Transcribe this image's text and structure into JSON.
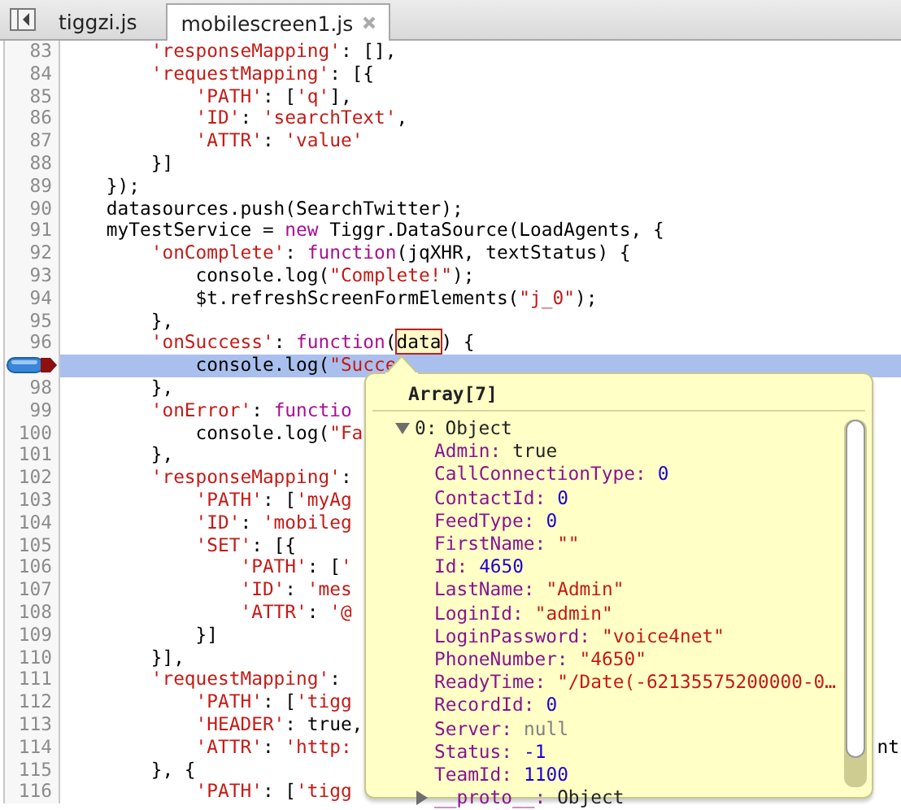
{
  "tabs": [
    {
      "label": "tiggzi.js",
      "selected": false,
      "closable": false
    },
    {
      "label": "mobilescreen1.js",
      "selected": true,
      "closable": true
    }
  ],
  "editor": {
    "lines": [
      {
        "number": "83",
        "tokens": [
          {
            "kind": "string",
            "text": "        'responseMapping'"
          },
          {
            "kind": "plain",
            "text": ": [],"
          }
        ]
      },
      {
        "number": "84",
        "tokens": [
          {
            "kind": "string",
            "text": "        'requestMapping'"
          },
          {
            "kind": "plain",
            "text": ": [{"
          }
        ]
      },
      {
        "number": "85",
        "tokens": [
          {
            "kind": "string",
            "text": "            'PATH'"
          },
          {
            "kind": "plain",
            "text": ": ["
          },
          {
            "kind": "string",
            "text": "'q'"
          },
          {
            "kind": "plain",
            "text": "],"
          }
        ]
      },
      {
        "number": "86",
        "tokens": [
          {
            "kind": "string",
            "text": "            'ID'"
          },
          {
            "kind": "plain",
            "text": ": "
          },
          {
            "kind": "string",
            "text": "'searchText'"
          },
          {
            "kind": "plain",
            "text": ","
          }
        ]
      },
      {
        "number": "87",
        "tokens": [
          {
            "kind": "string",
            "text": "            'ATTR'"
          },
          {
            "kind": "plain",
            "text": ": "
          },
          {
            "kind": "string",
            "text": "'value'"
          }
        ]
      },
      {
        "number": "88",
        "tokens": [
          {
            "kind": "plain",
            "text": "        }]"
          }
        ]
      },
      {
        "number": "89",
        "tokens": [
          {
            "kind": "plain",
            "text": "    });"
          }
        ]
      },
      {
        "number": "90",
        "tokens": [
          {
            "kind": "plain",
            "text": "    datasources.push(SearchTwitter);"
          }
        ]
      },
      {
        "number": "91",
        "tokens": [
          {
            "kind": "plain",
            "text": "    myTestService = "
          },
          {
            "kind": "keyword",
            "text": "new"
          },
          {
            "kind": "plain",
            "text": " Tiggr.DataSource(LoadAgents, {"
          }
        ]
      },
      {
        "number": "92",
        "tokens": [
          {
            "kind": "string",
            "text": "        'onComplete'"
          },
          {
            "kind": "plain",
            "text": ": "
          },
          {
            "kind": "keyword",
            "text": "function"
          },
          {
            "kind": "plain",
            "text": "(jqXHR, textStatus) {"
          }
        ]
      },
      {
        "number": "93",
        "tokens": [
          {
            "kind": "plain",
            "text": "            console.log("
          },
          {
            "kind": "string",
            "text": "\"Complete!\""
          },
          {
            "kind": "plain",
            "text": ");"
          }
        ]
      },
      {
        "number": "94",
        "tokens": [
          {
            "kind": "plain",
            "text": "            $t.refreshScreenFormElements("
          },
          {
            "kind": "string",
            "text": "\"j_0\""
          },
          {
            "kind": "plain",
            "text": ");"
          }
        ]
      },
      {
        "number": "95",
        "tokens": [
          {
            "kind": "plain",
            "text": "        },"
          }
        ]
      },
      {
        "number": "96",
        "tokens": [
          {
            "kind": "string",
            "text": "        'onSuccess'"
          },
          {
            "kind": "plain",
            "text": ": "
          },
          {
            "kind": "keyword",
            "text": "function"
          },
          {
            "kind": "plain",
            "text": "("
          },
          {
            "kind": "hover",
            "text": "data"
          },
          {
            "kind": "plain",
            "text": ") {"
          }
        ]
      },
      {
        "current": true,
        "breakpoint": true,
        "tokens": [
          {
            "kind": "plain",
            "text": "            console.log("
          },
          {
            "kind": "string",
            "text": "\"Succe"
          }
        ]
      },
      {
        "number": "98",
        "tokens": [
          {
            "kind": "plain",
            "text": "        },"
          }
        ]
      },
      {
        "number": "99",
        "tokens": [
          {
            "kind": "string",
            "text": "        'onError'"
          },
          {
            "kind": "plain",
            "text": ": "
          },
          {
            "kind": "keyword",
            "text": "functio"
          }
        ]
      },
      {
        "number": "100",
        "tokens": [
          {
            "kind": "plain",
            "text": "            console.log("
          },
          {
            "kind": "string",
            "text": "\"Fa"
          }
        ]
      },
      {
        "number": "101",
        "tokens": [
          {
            "kind": "plain",
            "text": "        },"
          }
        ]
      },
      {
        "number": "102",
        "tokens": [
          {
            "kind": "string",
            "text": "        'responseMapping'"
          },
          {
            "kind": "plain",
            "text": ":"
          }
        ]
      },
      {
        "number": "103",
        "tokens": [
          {
            "kind": "string",
            "text": "            'PATH'"
          },
          {
            "kind": "plain",
            "text": ": ["
          },
          {
            "kind": "string",
            "text": "'myAg"
          }
        ]
      },
      {
        "number": "104",
        "tokens": [
          {
            "kind": "string",
            "text": "            'ID'"
          },
          {
            "kind": "plain",
            "text": ": "
          },
          {
            "kind": "string",
            "text": "'mobileg"
          }
        ]
      },
      {
        "number": "105",
        "tokens": [
          {
            "kind": "string",
            "text": "            'SET'"
          },
          {
            "kind": "plain",
            "text": ": [{"
          }
        ]
      },
      {
        "number": "106",
        "tokens": [
          {
            "kind": "string",
            "text": "                'PATH'"
          },
          {
            "kind": "plain",
            "text": ": ["
          },
          {
            "kind": "string",
            "text": "'"
          }
        ]
      },
      {
        "number": "107",
        "tokens": [
          {
            "kind": "string",
            "text": "                'ID'"
          },
          {
            "kind": "plain",
            "text": ": "
          },
          {
            "kind": "string",
            "text": "'mes"
          }
        ]
      },
      {
        "number": "108",
        "tokens": [
          {
            "kind": "string",
            "text": "                'ATTR'"
          },
          {
            "kind": "plain",
            "text": ": "
          },
          {
            "kind": "string",
            "text": "'@"
          }
        ]
      },
      {
        "number": "109",
        "tokens": [
          {
            "kind": "plain",
            "text": "            }]"
          }
        ]
      },
      {
        "number": "110",
        "tokens": [
          {
            "kind": "plain",
            "text": "        }],"
          }
        ]
      },
      {
        "number": "111",
        "tokens": [
          {
            "kind": "string",
            "text": "        'requestMapping'"
          },
          {
            "kind": "plain",
            "text": ":"
          }
        ]
      },
      {
        "number": "112",
        "tokens": [
          {
            "kind": "string",
            "text": "            'PATH'"
          },
          {
            "kind": "plain",
            "text": ": ["
          },
          {
            "kind": "string",
            "text": "'tigg"
          }
        ]
      },
      {
        "number": "113",
        "tokens": [
          {
            "kind": "string",
            "text": "            'HEADER'"
          },
          {
            "kind": "plain",
            "text": ": true,"
          }
        ]
      },
      {
        "number": "114",
        "tokens": [
          {
            "kind": "string",
            "text": "            'ATTR'"
          },
          {
            "kind": "plain",
            "text": ": "
          },
          {
            "kind": "string",
            "text": "'http:"
          }
        ],
        "tail": "nt"
      },
      {
        "number": "115",
        "tokens": [
          {
            "kind": "plain",
            "text": "        }, {"
          }
        ]
      },
      {
        "number": "116",
        "tokens": [
          {
            "kind": "string",
            "text": "            'PATH'"
          },
          {
            "kind": "plain",
            "text": ": ["
          },
          {
            "kind": "string",
            "text": "'tigg"
          }
        ]
      }
    ]
  },
  "popover": {
    "title": "Array[7]",
    "items": [
      {
        "key": "0:",
        "value": "Object",
        "kind": "object",
        "expanded": true,
        "children": [
          {
            "key": "Admin:",
            "value": "true",
            "kind": "boolean"
          },
          {
            "key": "CallConnectionType:",
            "value": "0",
            "kind": "number"
          },
          {
            "key": "ContactId:",
            "value": "0",
            "kind": "number"
          },
          {
            "key": "FeedType:",
            "value": "0",
            "kind": "number"
          },
          {
            "key": "FirstName:",
            "value": "\"\"",
            "kind": "string"
          },
          {
            "key": "Id:",
            "value": "4650",
            "kind": "number"
          },
          {
            "key": "LastName:",
            "value": "\"Admin\"",
            "kind": "string"
          },
          {
            "key": "LoginId:",
            "value": "\"admin\"",
            "kind": "string"
          },
          {
            "key": "LoginPassword:",
            "value": "\"voice4net\"",
            "kind": "string"
          },
          {
            "key": "PhoneNumber:",
            "value": "\"4650\"",
            "kind": "string"
          },
          {
            "key": "ReadyTime:",
            "value": "\"/Date(-62135575200000-0…",
            "kind": "string"
          },
          {
            "key": "RecordId:",
            "value": "0",
            "kind": "number"
          },
          {
            "key": "Server:",
            "value": "null",
            "kind": "null"
          },
          {
            "key": "Status:",
            "value": "-1",
            "kind": "number"
          },
          {
            "key": "TeamId:",
            "value": "1100",
            "kind": "number"
          },
          {
            "key": "__proto__:",
            "value": "Object",
            "kind": "object",
            "expanded": false
          }
        ]
      }
    ]
  }
}
